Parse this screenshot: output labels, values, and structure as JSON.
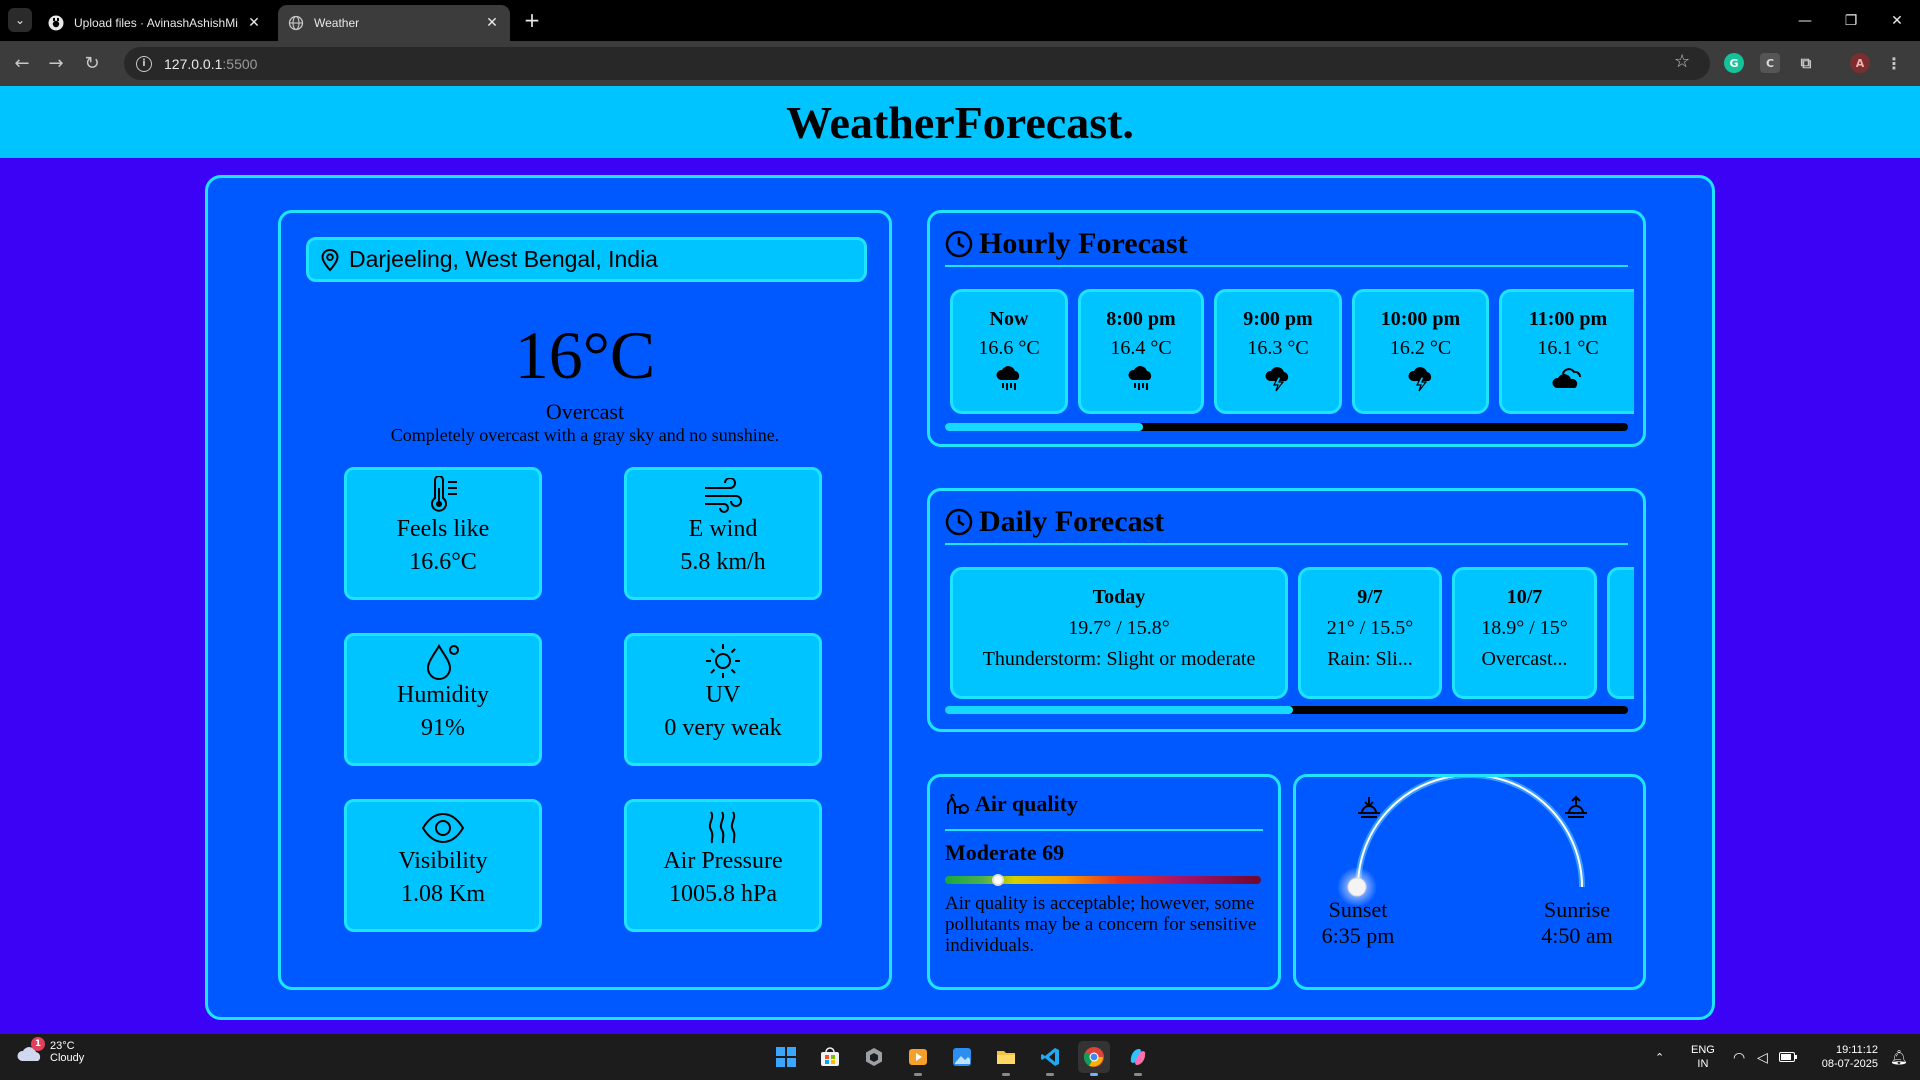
{
  "browser": {
    "tabs": [
      {
        "title": "Upload files · AvinashAshishMi",
        "active": false,
        "icon": "github-icon"
      },
      {
        "title": "Weather",
        "active": true,
        "icon": "globe-icon"
      }
    ],
    "url_host": "127.0.0.1",
    "url_port": ":5500",
    "profile_initial": "A",
    "extensions": [
      "grammarly-icon",
      "c-extension-icon",
      "puzzle-icon"
    ]
  },
  "site": {
    "title": "WeatherForecast."
  },
  "current": {
    "location": "Darjeeling, West Bengal, India",
    "temperature": "16°C",
    "condition": "Overcast",
    "description": "Completely overcast with a gray sky and no sunshine.",
    "tiles": [
      {
        "icon": "thermometer-icon",
        "label": "Feels like",
        "value": "16.6°C"
      },
      {
        "icon": "wind-icon",
        "label": "E wind",
        "value": "5.8 km/h"
      },
      {
        "icon": "humidity-icon",
        "label": "Humidity",
        "value": "91%"
      },
      {
        "icon": "sun-icon",
        "label": "UV",
        "value": "0 very weak"
      },
      {
        "icon": "eye-icon",
        "label": "Visibility",
        "value": "1.08 Km"
      },
      {
        "icon": "pressure-icon",
        "label": "Air Pressure",
        "value": "1005.8 hPa"
      }
    ]
  },
  "hourly": {
    "title": "Hourly Forecast",
    "items": [
      {
        "time": "Now",
        "temp": "16.6 °C",
        "icon": "rain-cloud-icon"
      },
      {
        "time": "8:00 pm",
        "temp": "16.4 °C",
        "icon": "rain-cloud-icon"
      },
      {
        "time": "9:00 pm",
        "temp": "16.3 °C",
        "icon": "thunder-cloud-icon"
      },
      {
        "time": "10:00 pm",
        "temp": "16.2 °C",
        "icon": "thunder-cloud-icon"
      },
      {
        "time": "11:00 pm",
        "temp": "16.1 °C",
        "icon": "cloudy-icon"
      }
    ],
    "scroll_position": 0.29
  },
  "daily": {
    "title": "Daily Forecast",
    "items": [
      {
        "day": "Today",
        "temps": "19.7° / 15.8°",
        "summary": "Thunderstorm: Slight or moderate"
      },
      {
        "day": "9/7",
        "temps": "21° / 15.5°",
        "summary": "Rain: Sli..."
      },
      {
        "day": "10/7",
        "temps": "18.9° / 15°",
        "summary": "Overcast..."
      }
    ],
    "scroll_position": 0.51
  },
  "air_quality": {
    "title": "Air quality",
    "rating": "Moderate 69",
    "indicator_position": 0.15,
    "text": "Air quality is acceptable; however, some pollutants may be a concern for sensitive individuals."
  },
  "sun": {
    "sunset_label": "Sunset",
    "sunset_time": "6:35 pm",
    "sunrise_label": "Sunrise",
    "sunrise_time": "4:50 am"
  },
  "taskbar": {
    "weather_temp": "23°C",
    "weather_text": "Cloudy",
    "weather_badge": "1",
    "apps": [
      "windows-start-icon",
      "store-icon",
      "app-icon",
      "media-player-icon",
      "photos-icon",
      "file-explorer-icon",
      "vscode-icon",
      "chrome-icon",
      "copilot-icon"
    ],
    "lang": "ENG",
    "region": "IN",
    "time": "19:11:12",
    "date": "08-07-2025"
  },
  "colors": {
    "page_bg": "#3b02f5",
    "panel_bg": "#0059ff",
    "card_bg": "#00c4ff",
    "border": "#1de4ff"
  }
}
